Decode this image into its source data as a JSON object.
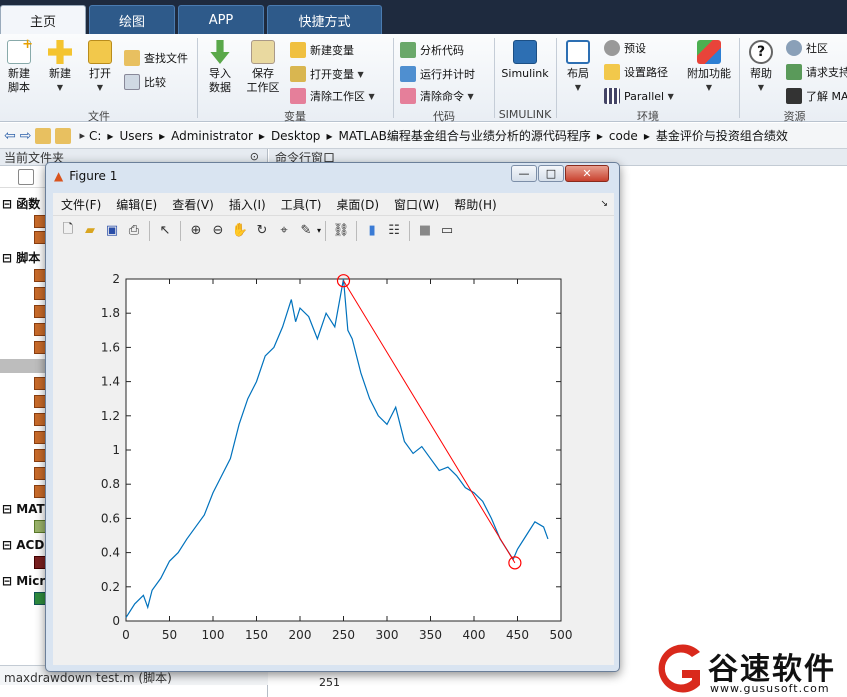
{
  "tabs": [
    {
      "label": "主页"
    },
    {
      "label": "绘图"
    },
    {
      "label": "APP"
    },
    {
      "label": "快捷方式"
    }
  ],
  "ribbon": {
    "new_script": "新建\n脚本",
    "new": "新建",
    "open": "打开",
    "find_files": "查找文件",
    "compare": "比较",
    "import_data": "导入\n数据",
    "save_workspace": "保存\n工作区",
    "new_variable": "新建变量",
    "open_variable": "打开变量",
    "clear_workspace": "清除工作区",
    "analyze_code": "分析代码",
    "run_and_time": "运行并计时",
    "clear_commands": "清除命令",
    "simulink": "Simulink",
    "layout": "布局",
    "preferences": "预设",
    "set_path": "设置路径",
    "parallel": "Parallel",
    "addons": "附加功能",
    "help": "帮助",
    "community": "社区",
    "request_support": "请求支持",
    "learn_matlab": "了解 MA",
    "sections": {
      "file": "文件",
      "variable": "变量",
      "code": "代码",
      "simulink": "SIMULINK",
      "environment": "环境",
      "resources": "资源"
    }
  },
  "address": {
    "crumbs": [
      "C:",
      "Users",
      "Administrator",
      "Desktop",
      "MATLAB编程基金组合与业绩分析的源代码程序",
      "code",
      "基金评价与投资组合绩效"
    ]
  },
  "left_panel": {
    "title": "当前文件夹",
    "groups": [
      "函数",
      "脚本",
      "MAT",
      "ACD",
      "Micr"
    ],
    "footer": "maxdrawdown test.m  (脚本)"
  },
  "command_window": {
    "title": "命令行窗口",
    "bottom_text": "251"
  },
  "figure": {
    "title": "Figure 1",
    "menus": [
      "文件(F)",
      "编辑(E)",
      "查看(V)",
      "插入(I)",
      "工具(T)",
      "桌面(D)",
      "窗口(W)",
      "帮助(H)"
    ],
    "buttons": {
      "minimize": "—",
      "maximize": "□",
      "close": "✕"
    }
  },
  "watermark": {
    "brand": "谷速软件",
    "url": "www.gususoft.com"
  },
  "chart_data": {
    "type": "line",
    "title": "",
    "xlabel": "",
    "ylabel": "",
    "xlim": [
      0,
      500
    ],
    "ylim": [
      0,
      2
    ],
    "xticks": [
      0,
      50,
      100,
      150,
      200,
      250,
      300,
      350,
      400,
      450,
      500
    ],
    "yticks": [
      0,
      0.2,
      0.4,
      0.6,
      0.8,
      1,
      1.2,
      1.4,
      1.6,
      1.8,
      2
    ],
    "grid": false,
    "series": [
      {
        "color": "#0072BD",
        "x": [
          0,
          10,
          20,
          25,
          30,
          40,
          50,
          60,
          70,
          80,
          90,
          100,
          110,
          120,
          130,
          140,
          150,
          160,
          170,
          180,
          190,
          195,
          200,
          210,
          220,
          230,
          240,
          250,
          255,
          260,
          270,
          280,
          290,
          300,
          310,
          320,
          330,
          340,
          350,
          360,
          370,
          380,
          390,
          400,
          410,
          420,
          430,
          440,
          445,
          450,
          460,
          470,
          480,
          485
        ],
        "y": [
          0.02,
          0.1,
          0.15,
          0.08,
          0.18,
          0.25,
          0.35,
          0.4,
          0.48,
          0.55,
          0.62,
          0.75,
          0.85,
          0.95,
          1.15,
          1.3,
          1.4,
          1.55,
          1.6,
          1.72,
          1.88,
          1.75,
          1.83,
          1.78,
          1.65,
          1.8,
          1.72,
          2.0,
          1.7,
          1.65,
          1.45,
          1.3,
          1.2,
          1.15,
          1.25,
          1.05,
          0.98,
          1.02,
          0.95,
          0.88,
          0.9,
          0.85,
          0.78,
          0.75,
          0.7,
          0.6,
          0.48,
          0.4,
          0.36,
          0.42,
          0.5,
          0.58,
          0.55,
          0.48
        ]
      }
    ],
    "drawdown": {
      "color": "#FF0000",
      "peak": {
        "x": 250,
        "y": 1.99
      },
      "trough": {
        "x": 447,
        "y": 0.34
      }
    }
  }
}
